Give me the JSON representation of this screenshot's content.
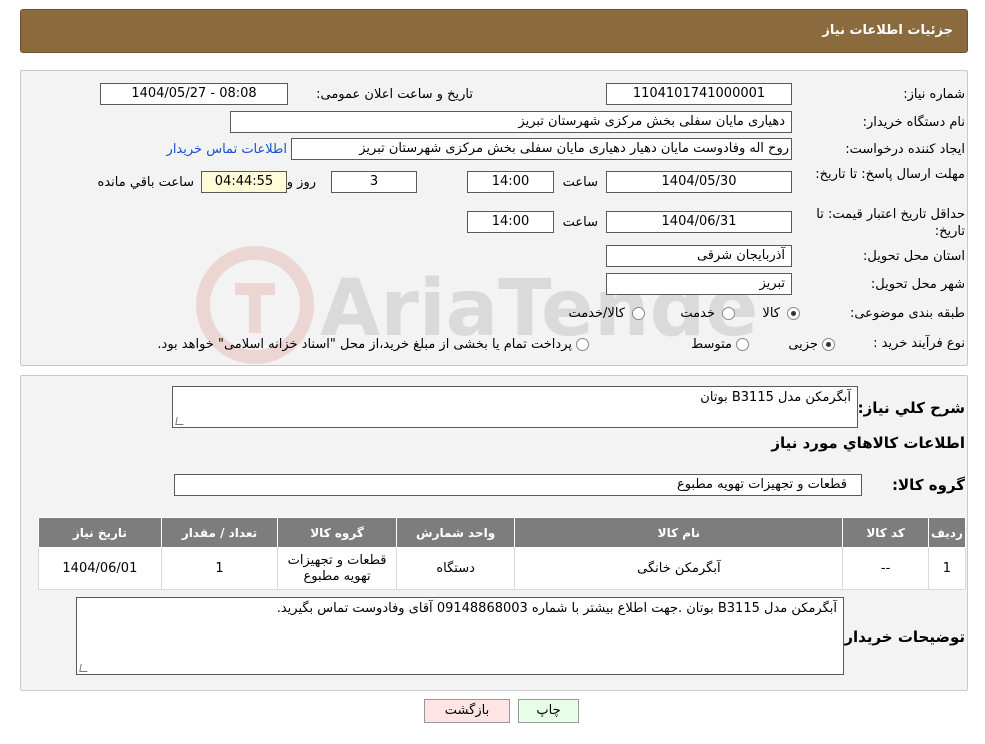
{
  "header": {
    "title": "جزئیات اطلاعات نیاز"
  },
  "need_number": {
    "label": "شماره نیاز:",
    "value": "1104101741000001"
  },
  "announce_datetime": {
    "label": "تاریخ و ساعت اعلان عمومی:",
    "value": "1404/05/27 - 08:08"
  },
  "buyer_org": {
    "label": "نام دستگاه خریدار:",
    "value": "دهیاری مایان سفلی بخش مرکزی شهرستان تبریز"
  },
  "requester": {
    "label": "ایجاد کننده درخواست:",
    "value": "روح اله وفادوست مایان دهیار دهیاری مایان سفلی بخش مرکزی شهرستان تبریز",
    "contact_link": "اطلاعات تماس خریدار"
  },
  "reply_deadline": {
    "label": "مهلت ارسال پاسخ: تا تاریخ:",
    "date": "1404/05/30",
    "time_label": "ساعت",
    "time": "14:00",
    "days": "3",
    "days_label": "روز و",
    "remaining": "04:44:55",
    "remaining_label": "ساعت باقي مانده"
  },
  "price_validity": {
    "label": "حداقل تاریخ اعتبار قیمت: تا تاریخ:",
    "date": "1404/06/31",
    "time_label": "ساعت",
    "time": "14:00"
  },
  "delivery_province": {
    "label": "استان محل تحویل:",
    "value": "آذربایجان شرقی"
  },
  "delivery_city": {
    "label": "شهر محل تحویل:",
    "value": "تبریز"
  },
  "category": {
    "label": "طبقه بندی موضوعی:",
    "options": [
      "کالا",
      "خدمت",
      "کالا/خدمت"
    ],
    "selected": 0
  },
  "process_type": {
    "label": "نوع فرآیند خرید :",
    "options": [
      "جزیی",
      "متوسط"
    ],
    "selected": 0,
    "note": "پرداخت تمام یا بخشی از مبلغ خرید،از محل \"اسناد خزانه اسلامی\" خواهد بود."
  },
  "description": {
    "label": "شرح کلي نياز:",
    "value": "آبگرمکن مدل B3115 بوتان"
  },
  "goods_info": {
    "title": "اطلاعات کالاهاي مورد نياز"
  },
  "goods_group": {
    "label": "گروه کالا:",
    "value": "قطعات و تجهیزات تهویه مطبوع"
  },
  "table": {
    "headers": [
      "ردیف",
      "کد کالا",
      "نام کالا",
      "واحد شمارش",
      "گروه کالا",
      "تعداد / مقدار",
      "تاریخ نیاز"
    ],
    "rows": [
      [
        "1",
        "--",
        "آبگرمکن خانگی",
        "دستگاه",
        "قطعات و تجهیزات تهویه مطبوع",
        "1",
        "1404/06/01"
      ]
    ]
  },
  "buyer_notes": {
    "label": "توضیحات خریدار:",
    "value": "آبگرمکن مدل B3115 بوتان .جهت اطلاع بیشتر با شماره 09148868003 آقای وفادوست تماس بگیرید."
  },
  "buttons": {
    "print": "چاپ",
    "back": "بازگشت"
  },
  "watermark": {
    "text": "AriaTender.neT"
  },
  "colors": {
    "header_bg": "#8b6a3e",
    "table_header_bg": "#7d7d7d",
    "link": "#1a4fd0",
    "timer_bg": "#fffbd6",
    "back_button_bg": "#ffe4e4",
    "print_button_bg": "#e6ffe6"
  }
}
